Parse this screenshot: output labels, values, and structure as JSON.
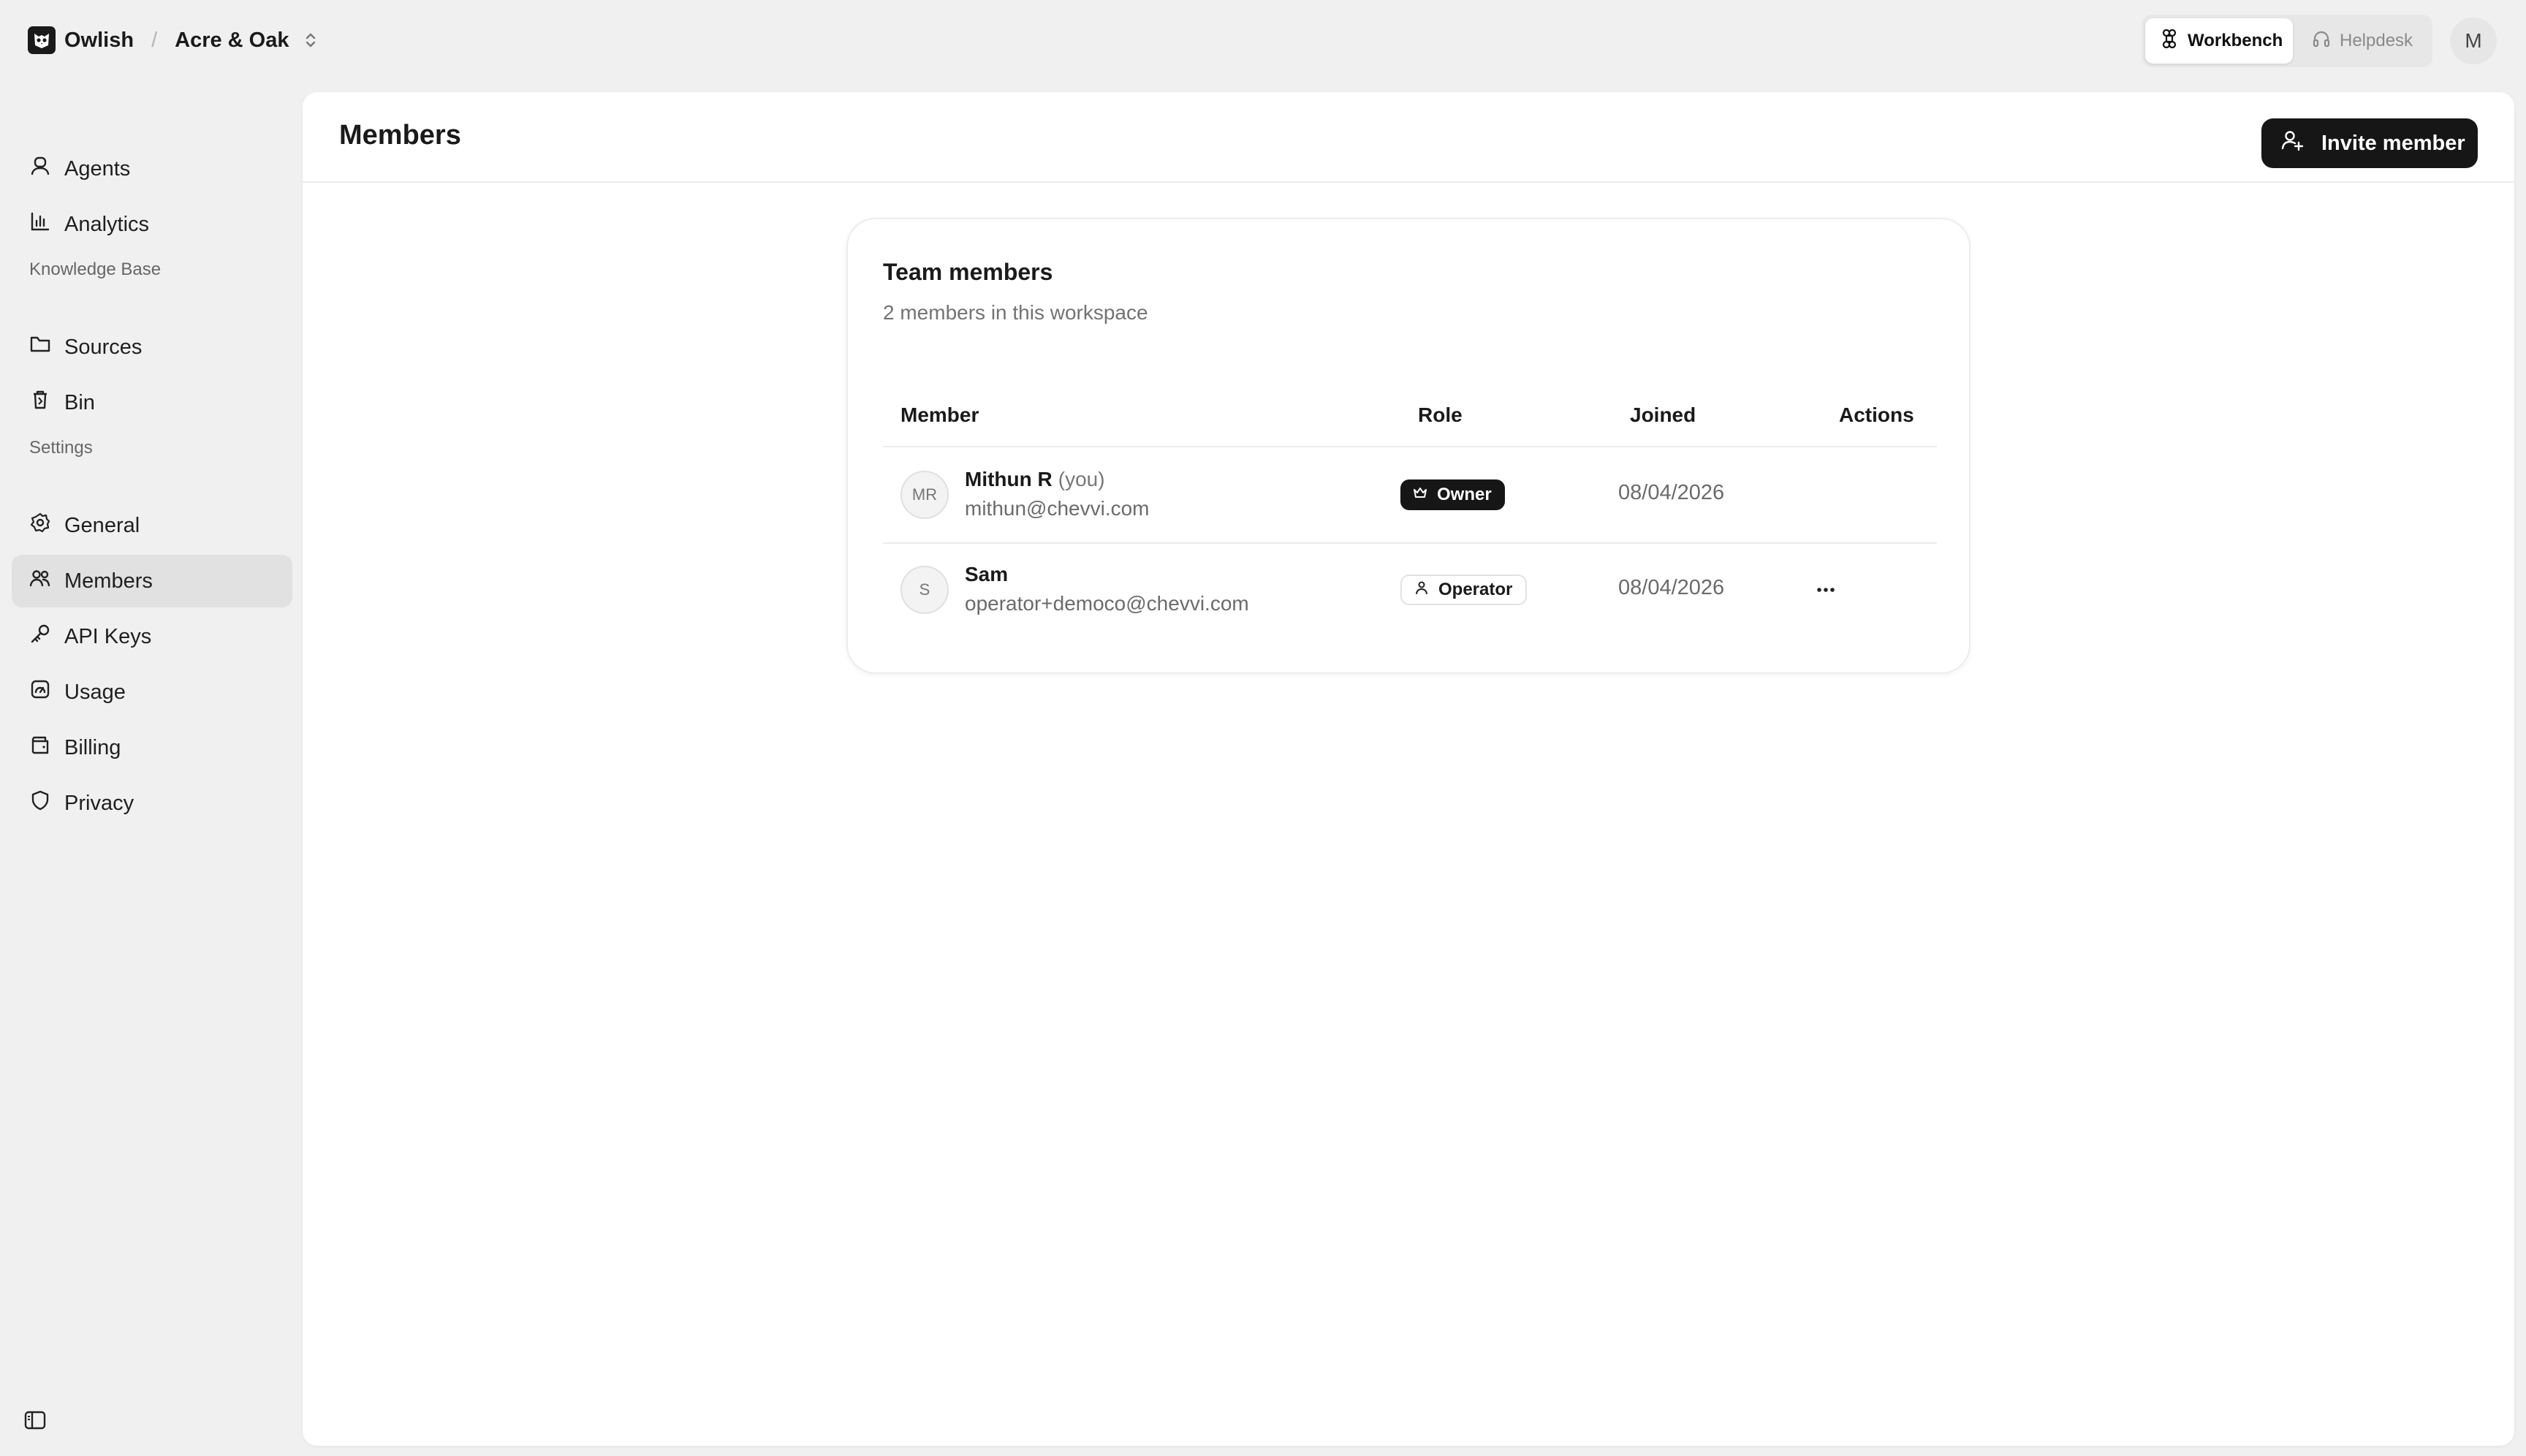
{
  "topbar": {
    "brand": "Owlish",
    "separator": "/",
    "workspace": "Acre & Oak",
    "modes": [
      {
        "label": "Workbench",
        "icon": "command-icon",
        "active": true
      },
      {
        "label": "Helpdesk",
        "icon": "headphones-icon",
        "active": false
      }
    ],
    "user_initial": "M"
  },
  "sidebar": {
    "items_top": [
      {
        "label": "Agents",
        "icon": "agent-icon"
      },
      {
        "label": "Analytics",
        "icon": "bar-chart-icon"
      }
    ],
    "knowledge_label": "Knowledge Base",
    "items_kb": [
      {
        "label": "Sources",
        "icon": "folder-icon"
      },
      {
        "label": "Bin",
        "icon": "trash-icon"
      }
    ],
    "settings_label": "Settings",
    "items_settings": [
      {
        "label": "General",
        "icon": "gear-icon"
      },
      {
        "label": "Members",
        "icon": "users-icon",
        "active": true
      },
      {
        "label": "API Keys",
        "icon": "key-icon"
      },
      {
        "label": "Usage",
        "icon": "gauge-icon"
      },
      {
        "label": "Billing",
        "icon": "wallet-icon"
      },
      {
        "label": "Privacy",
        "icon": "shield-icon"
      }
    ]
  },
  "main": {
    "title": "Members",
    "invite_label": "Invite member"
  },
  "card": {
    "title": "Team members",
    "subtitle": "2 members in this workspace",
    "columns": [
      "Member",
      "Role",
      "Joined",
      "Actions"
    ],
    "rows": [
      {
        "initials": "MR",
        "name": "Mithun R",
        "you": "(you)",
        "email": "mithun@chevvi.com",
        "role": "Owner",
        "joined": "08/04/2026"
      },
      {
        "initials": "S",
        "name": "Sam",
        "you": "",
        "email": "operator+democo@chevvi.com",
        "role": "Operator",
        "joined": "08/04/2026"
      }
    ]
  }
}
